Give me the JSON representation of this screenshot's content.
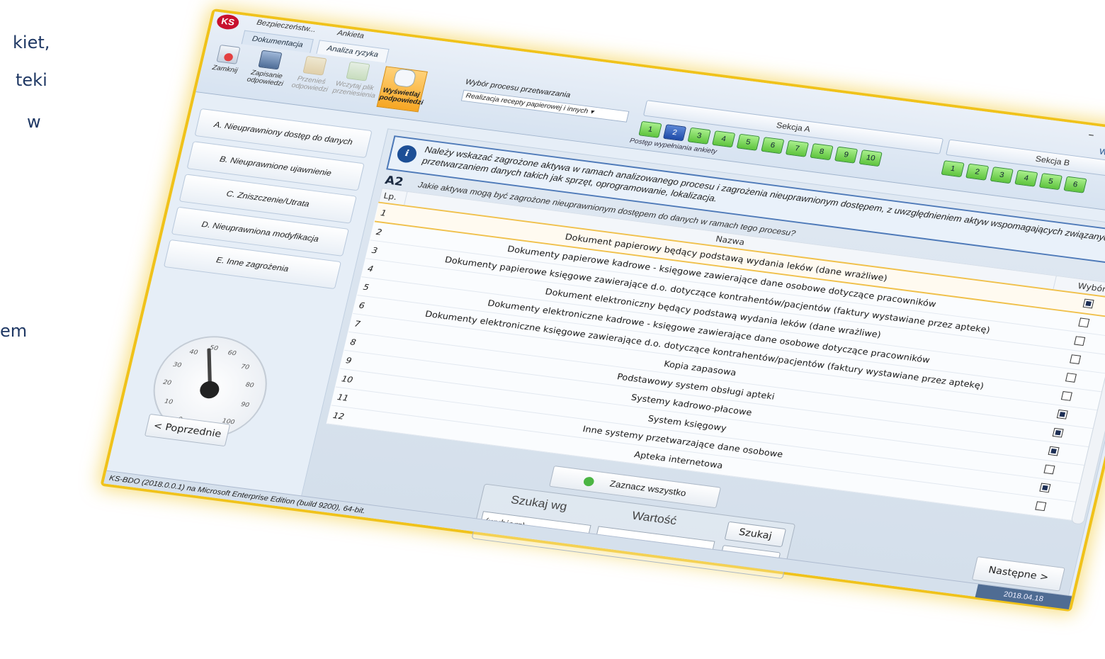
{
  "slide_fragments": [
    "kiet,",
    "teki",
    "w",
    "em"
  ],
  "app": {
    "title_tabs": [
      "Bezpieczeństw...",
      "Ankieta"
    ],
    "ribbon_tabs": [
      "Dokumentacja",
      "Analiza ryzyka"
    ],
    "window_controls": "–  □",
    "collab": "Współpraca z KS-",
    "toolbar": {
      "close": "Zamknij",
      "save": "Zapisanie odpowiedzi",
      "transfer": "Przenieś odpowiedzi",
      "load_file": "Wczytaj plik przeniesienia",
      "show_answers": "Wyświetlaj podpowiedzi"
    },
    "process": {
      "label": "Wybór procesu przetwarzania",
      "value": "Realizacja recepty papierowej i innych"
    },
    "sections": [
      "Sekcja A",
      "Sekcja B"
    ],
    "steps_a": [
      "1",
      "2",
      "3",
      "4",
      "5",
      "6",
      "7",
      "8",
      "9",
      "10"
    ],
    "steps_b": [
      "1",
      "2",
      "3",
      "4",
      "5",
      "6"
    ],
    "progress_label": "Postęp wypełniania ankiety"
  },
  "categories": [
    "A. Nieuprawniony dostęp do danych",
    "B. Nieuprawnione ujawnienie",
    "C. Zniszczenie/Utrata",
    "D. Nieuprawniona modyfikacja",
    "E. Inne zagrożenia"
  ],
  "gauge": {
    "ticks": [
      "0",
      "10",
      "20",
      "30",
      "40",
      "50",
      "60",
      "70",
      "80",
      "90",
      "100"
    ],
    "value": 45
  },
  "info": "Należy wskazać zagrożone aktywa w ramach analizowanego procesu i zagrożenia nieuprawnionym dostępem, z uwzględnieniem aktyw wspomagających związanych z przetwarzaniem danych takich jak sprzęt, oprogramowanie, lokalizacja.",
  "question": {
    "id": "A2",
    "text": "Jakie aktywa mogą być zagrożone nieuprawnionym dostępem do danych w ramach tego procesu?"
  },
  "table": {
    "headers": [
      "Lp.",
      "Nazwa",
      "Wybór"
    ],
    "rows": [
      {
        "lp": "1",
        "name": "Dokument papierowy będący podstawą wydania leków (dane wrażliwe)",
        "checked": true
      },
      {
        "lp": "2",
        "name": "Dokumenty papierowe kadrowe - księgowe zawierające dane osobowe  dotyczące pracowników",
        "checked": false
      },
      {
        "lp": "3",
        "name": "Dokumenty papierowe księgowe zawierające d.o. dotyczące kontrahentów/pacjentów (faktury wystawiane przez aptekę)",
        "checked": false
      },
      {
        "lp": "4",
        "name": "Dokument elektroniczny będący podstawą wydania leków (dane wrażliwe)",
        "checked": false
      },
      {
        "lp": "5",
        "name": "Dokumenty elektroniczne kadrowe - księgowe zawierające dane osobowe  dotyczące pracowników",
        "checked": false
      },
      {
        "lp": "6",
        "name": "Dokumenty elektroniczne księgowe zawierające d.o. dotyczące kontrahentów/pacjentów (faktury wystawiane przez aptekę)",
        "checked": false
      },
      {
        "lp": "7",
        "name": "Kopia zapasowa",
        "checked": true
      },
      {
        "lp": "8",
        "name": "Podstawowy system obsługi apteki",
        "checked": true
      },
      {
        "lp": "9",
        "name": "Systemy kadrowo-płacowe",
        "checked": true
      },
      {
        "lp": "10",
        "name": "System księgowy",
        "checked": false
      },
      {
        "lp": "11",
        "name": "Inne systemy przetwarzające dane osobowe",
        "checked": true
      },
      {
        "lp": "12",
        "name": "Apteka internetowa",
        "checked": false
      }
    ]
  },
  "mark_all": "Zaznacz wszystko",
  "search": {
    "by_label": "Szukaj wg",
    "value_label": "Wartość",
    "select_value": "(wybierz)",
    "search_button": "Szukaj",
    "add_button": "+"
  },
  "nav": {
    "prev": "< Poprzednie",
    "next": "Następne >"
  },
  "status": {
    "text": "KS-BDO (2018.0.0.1) na Microsoft Enterprise Edition (build 9200), 64-bit.",
    "date": "2018.04.18"
  }
}
